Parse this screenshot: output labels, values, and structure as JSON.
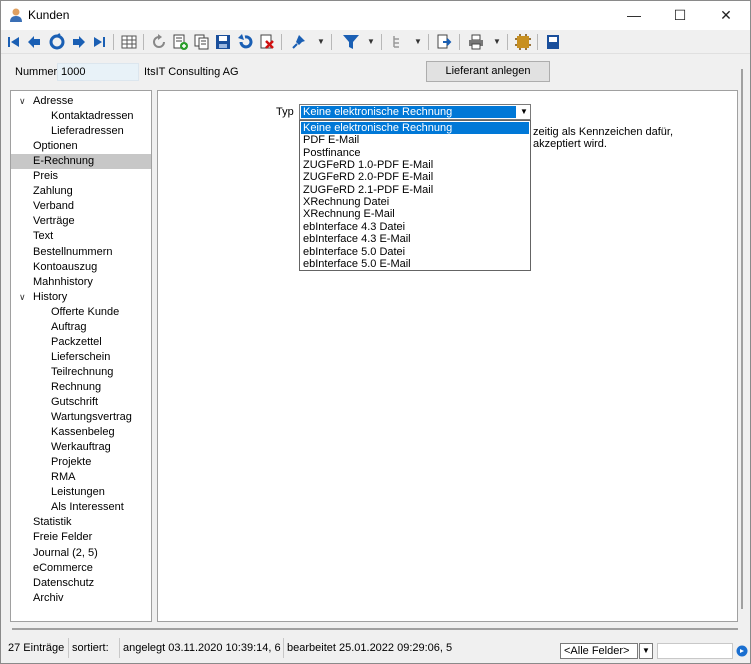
{
  "window": {
    "title": "Kunden"
  },
  "toolbar": {
    "icons": [
      "first-icon",
      "prev-icon",
      "search-icon",
      "next-icon",
      "last-icon",
      "grid-icon",
      "refresh-icon",
      "new-icon",
      "copy-icon",
      "save-icon",
      "undo-icon",
      "delete-icon",
      "pin-icon",
      "filter-icon",
      "tree-icon",
      "document-icon",
      "print-icon",
      "plugin-icon",
      "form-icon"
    ]
  },
  "header": {
    "number_label": "Nummer",
    "number_value": "1000",
    "customer_name": "ItsIT Consulting AG",
    "lieferant_button": "Lieferant anlegen"
  },
  "tree": {
    "items": [
      {
        "label": "Adresse",
        "level": 0,
        "expander": "open"
      },
      {
        "label": "Kontaktadressen",
        "level": 1
      },
      {
        "label": "Lieferadressen",
        "level": 1
      },
      {
        "label": "Optionen",
        "level": 0
      },
      {
        "label": "E-Rechnung",
        "level": 0,
        "selected": true
      },
      {
        "label": "Preis",
        "level": 0
      },
      {
        "label": "Zahlung",
        "level": 0
      },
      {
        "label": "Verband",
        "level": 0
      },
      {
        "label": "Verträge",
        "level": 0
      },
      {
        "label": "Text",
        "level": 0
      },
      {
        "label": "Bestellnummern",
        "level": 0
      },
      {
        "label": "Kontoauszug",
        "level": 0
      },
      {
        "label": "Mahnhistory",
        "level": 0
      },
      {
        "label": "History",
        "level": 0,
        "expander": "open"
      },
      {
        "label": "Offerte Kunde",
        "level": 1
      },
      {
        "label": "Auftrag",
        "level": 1
      },
      {
        "label": "Packzettel",
        "level": 1
      },
      {
        "label": "Lieferschein",
        "level": 1
      },
      {
        "label": "Teilrechnung",
        "level": 1
      },
      {
        "label": "Rechnung",
        "level": 1
      },
      {
        "label": "Gutschrift",
        "level": 1
      },
      {
        "label": "Wartungsvertrag",
        "level": 1
      },
      {
        "label": "Kassenbeleg",
        "level": 1
      },
      {
        "label": "Werkauftrag",
        "level": 1
      },
      {
        "label": "Projekte",
        "level": 1
      },
      {
        "label": "RMA",
        "level": 1
      },
      {
        "label": "Leistungen",
        "level": 1
      },
      {
        "label": "Als Interessent",
        "level": 1
      },
      {
        "label": "Statistik",
        "level": 0
      },
      {
        "label": "Freie Felder",
        "level": 0
      },
      {
        "label": "Journal (2, 5)",
        "level": 0
      },
      {
        "label": "eCommerce",
        "level": 0
      },
      {
        "label": "Datenschutz",
        "level": 0
      },
      {
        "label": "Archiv",
        "level": 0
      }
    ]
  },
  "erechnung": {
    "typ_label": "Typ",
    "selected": "Keine elektronische Rechnung",
    "note_line1": "zeitig als Kennzeichen dafür,",
    "note_line2": "akzeptiert wird.",
    "options": [
      "Keine elektronische Rechnung",
      "PDF E-Mail",
      "Postfinance",
      "ZUGFeRD 1.0-PDF E-Mail",
      "ZUGFeRD 2.0-PDF E-Mail",
      "ZUGFeRD 2.1-PDF E-Mail",
      "XRechnung Datei",
      "XRechnung E-Mail",
      "ebInterface 4.3 Datei",
      "ebInterface 4.3 E-Mail",
      "ebInterface 5.0 Datei",
      "ebInterface 5.0 E-Mail"
    ],
    "highlighted_index": 0
  },
  "status": {
    "count": "27 Einträge",
    "sorted": "sortiert:",
    "created": "angelegt 03.11.2020 10:39:14,  6",
    "edited": "bearbeitet 25.01.2022 09:29:06,  5",
    "field_select": "<Alle Felder>"
  }
}
